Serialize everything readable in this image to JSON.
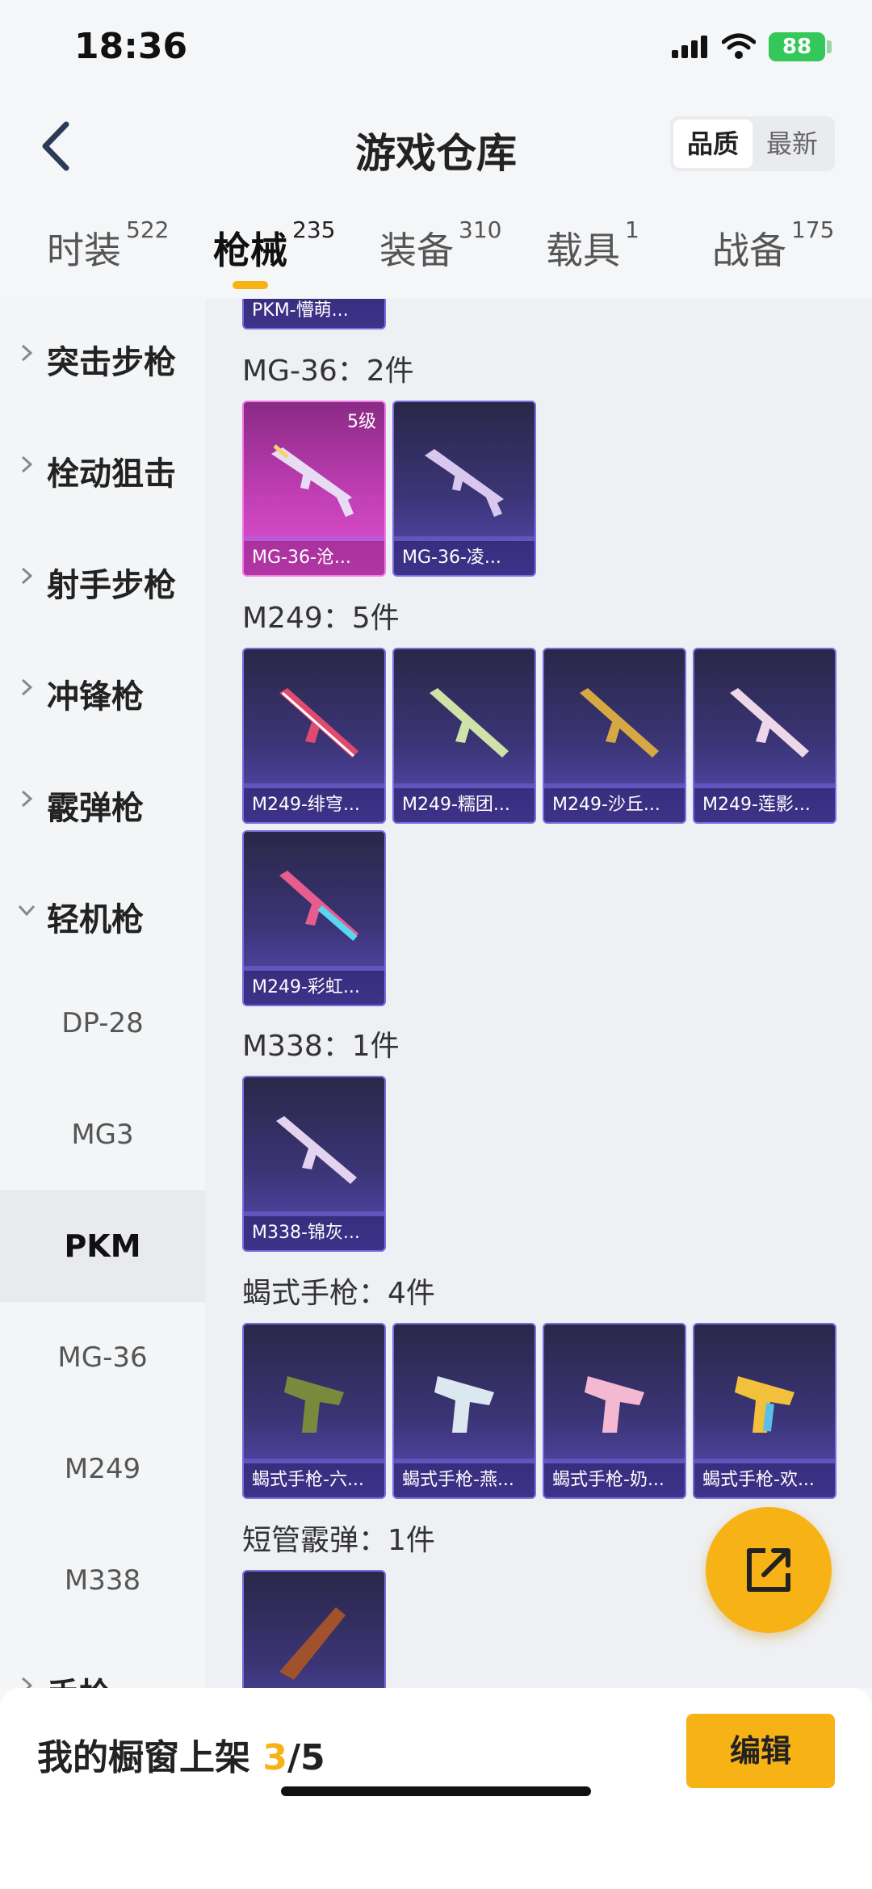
{
  "status_bar": {
    "time": "18:36",
    "battery": "88"
  },
  "header": {
    "title": "游戏仓库",
    "sort_options": [
      "品质",
      "最新"
    ],
    "sort_active": "品质"
  },
  "tabs": [
    {
      "label": "时装",
      "count": "522"
    },
    {
      "label": "枪械",
      "count": "235",
      "active": true
    },
    {
      "label": "装备",
      "count": "310"
    },
    {
      "label": "载具",
      "count": "1"
    },
    {
      "label": "战备",
      "count": "175"
    }
  ],
  "sidebar": {
    "categories": [
      "突击步枪",
      "栓动狙击",
      "射手步枪",
      "冲锋枪",
      "霰弹枪",
      "轻机枪"
    ],
    "sub_items": [
      "DP-28",
      "MG3",
      "PKM",
      "MG-36",
      "M249",
      "M338"
    ],
    "active_sub": "PKM",
    "partial_category": "手枪"
  },
  "main": {
    "partial_card_name": "PKM-懵萌...",
    "sections": [
      {
        "title": "MG-36：2件",
        "items": [
          {
            "name": "MG-36-沧...",
            "level": "5级",
            "rarity": "pink"
          },
          {
            "name": "MG-36-凌...",
            "rarity": "purple"
          }
        ]
      },
      {
        "title": "M249：5件",
        "items": [
          {
            "name": "M249-绯穹...",
            "rarity": "purple"
          },
          {
            "name": "M249-糯团...",
            "rarity": "purple"
          },
          {
            "name": "M249-沙丘...",
            "rarity": "purple"
          },
          {
            "name": "M249-莲影...",
            "rarity": "purple"
          },
          {
            "name": "M249-彩虹...",
            "rarity": "purple"
          }
        ]
      },
      {
        "title": "M338：1件",
        "items": [
          {
            "name": "M338-锦灰...",
            "rarity": "purple"
          }
        ]
      },
      {
        "title": "蝎式手枪：4件",
        "items": [
          {
            "name": "蝎式手枪-六...",
            "rarity": "purple"
          },
          {
            "name": "蝎式手枪-燕...",
            "rarity": "purple"
          },
          {
            "name": "蝎式手枪-奶...",
            "rarity": "purple"
          },
          {
            "name": "蝎式手枪-欢...",
            "rarity": "purple"
          }
        ]
      },
      {
        "title": "短管霰弹：1件",
        "items": [
          {
            "name": "",
            "rarity": "purple"
          }
        ]
      }
    ]
  },
  "bottom_bar": {
    "label": "我的橱窗上架 ",
    "shown": "3",
    "total": "/5",
    "edit_label": "编辑"
  },
  "colors": {
    "accent": "#f7b216",
    "purple_card": "#3b3577",
    "pink_card": "#c23fb5"
  },
  "icons": [
    "back-chevron-icon",
    "signal-icon",
    "wifi-icon",
    "battery-icon",
    "chevron-right-icon",
    "chevron-down-icon",
    "share-out-icon"
  ]
}
